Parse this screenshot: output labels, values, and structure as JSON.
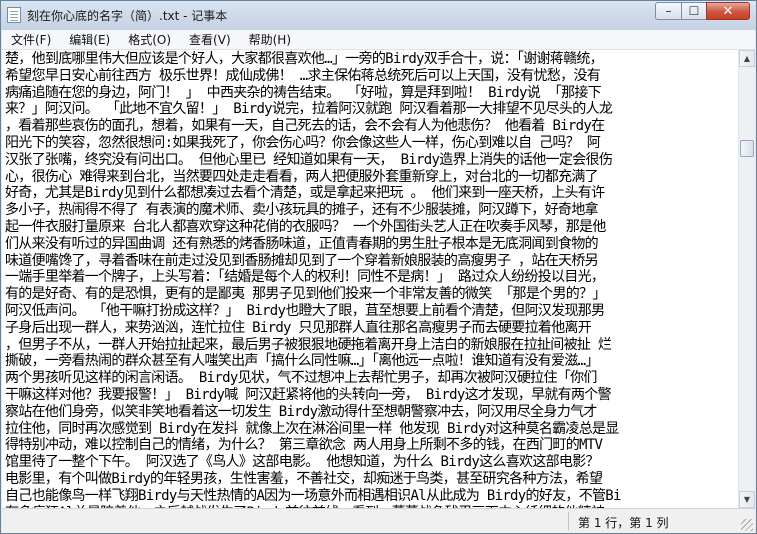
{
  "window": {
    "title": "刻在你心底的名字（简）.txt - 记事本",
    "controls": {
      "minimize": "–",
      "maximize": "☐",
      "close": "✕"
    }
  },
  "menu": {
    "file": "文件(F)",
    "edit": "编辑(E)",
    "format": "格式(O)",
    "view": "查看(V)",
    "help": "帮助(H)"
  },
  "editor": {
    "lines": [
      "楚，他到底哪里伟大但应该是个好人，大家都很喜欢他…」一旁的Birdy双手合十，说：「谢谢蒋赣统，",
      "希望您早日安心前往西方 极乐世界！成仙成佛！ …求主保佑蒋总统死后可以上天国，没有忧愁，没有",
      "病痛追随在您的身边，阿门！ 」 中西夹杂的祷告结束。 「好啦，算是拜到啦！ Birdy说 「那接下",
      "来？」阿汉问。 「此地不宜久留！」 Birdy说完，拉着阿汉就跑 阿汉看着那一大排望不见尽头的人龙",
      "，看着那些哀伤的面孔，想着，如果有一天，自己死去的话，会不会有人为他悲伤？ 他看着 Birdy在",
      "阳光下的笑容，忽然很想问:如果我死了，你会伤心吗？你会像这些人一样，伤心到难以自 己吗？ 阿",
      "汉张了张嘴，终究没有问出口。 但他心里已 经知道如果有一天， Birdy造界上消失的话他一定会很伤",
      "心，很伤心 难得来到台北，当然要四处走走看看，两人把便服外套重新穿上，对台北的一切都充满了",
      "好奇，尤其是Birdy见到什么都想凑过去看个清楚，或是拿起来把玩 。 他们来到一座天桥，上头有许",
      "多小子，热闹得不得了 有表演的魔术师、卖小孩玩具的摊子，还有不少服装摊，阿汉蹲下，好奇地拿",
      "起一件衣服打量原来 台北人都喜欢穿这种花俏的衣服吗？ 一个外国街头艺人正在吹奏手风琴，那是他",
      "们从来没有听过的异国曲调 还有熟悉的烤香肠味道，正值青春期的男生肚子根本是无底洞闻到食物的",
      "味道便嘴馋了，寻着香味在前走过没见到香肠摊却见到了一个穿着新娘服装的高瘦男子 ，站在天桥另",
      "一端手里举着一个牌子，上头写着：「结婚是每个人的权利！同性不是病！」 路过众人纷纷投以目光，",
      "有的是好奇、有的是恐惧，更有的是鄙夷 那男子见到他们投来一个非常友善的微笑 「那是个男的？」",
      "阿汉低声问。 「他干嘛打扮成这样？」 Birdy也瞪大了眼，苴至想要上前看个清楚，但阿汉发现那男",
      "子身后出现一群人，来势汹汹，连忙拉住 Birdy 只见那群人直往那名高瘦男子而去硬要拉着他离开 ",
      "，但男子不从，一群人开始拉扯起来，最后男子被狠狠地硬拖着离开身上洁白的新娘服在拉扯间被扯 烂",
      "撕破，一旁看热闹的群众甚至有人嗤笑出声「搞什么同性嘛…」「离他远一点啦！谁知道有没有爱滋…」",
      "两个男孩听见这样的闲言闲语。 Birdy见状，气不过想冲上去帮忙男子，却再次被阿汉硬拉住「你们",
      "干嘛这样对他？我要报警！」 Birdy喊 阿汉赶紧将他的头转向一旁， Birdy这才发现，早就有两个警",
      "察站在他们身旁，似笑非笑地看着这一切发生 Birdy激动得什至想朝警察冲去，阿汉用尽全身力气才",
      "拉住他，同时再次感觉到 Birdy在发抖 就像上次在淋浴间里一样 他发现 Birdy对这种莫名霸凌总是显",
      "得特别冲动，难以控制自己的情绪，为什么？ 第三章欲念 两人用身上所剩不多的钱，在西门町的MTV",
      "馆里待了一整个下午。 阿汉选了《鸟人》这部电影。 他想知道，为什么 Birdy这么喜欢这部电影？",
      "电影里，有个叫做Birdy的年轻男孩，生性害羞，不善社交，却痴迷于鸟类，甚至研究各种方法，希望",
      "自己也能像鸟一样飞翔Birdy与天性热情的A因为一场意外而相遇相识Al从此成为 Birdy的好友，不管Bi",
      "有多疯狂Al总是陪着他，之后越战发生了Birdy前往前线，看到一幕幕战争残忍画面内心纤细的他精神"
    ]
  },
  "status": {
    "position": "第 1 行，第 1 列"
  }
}
